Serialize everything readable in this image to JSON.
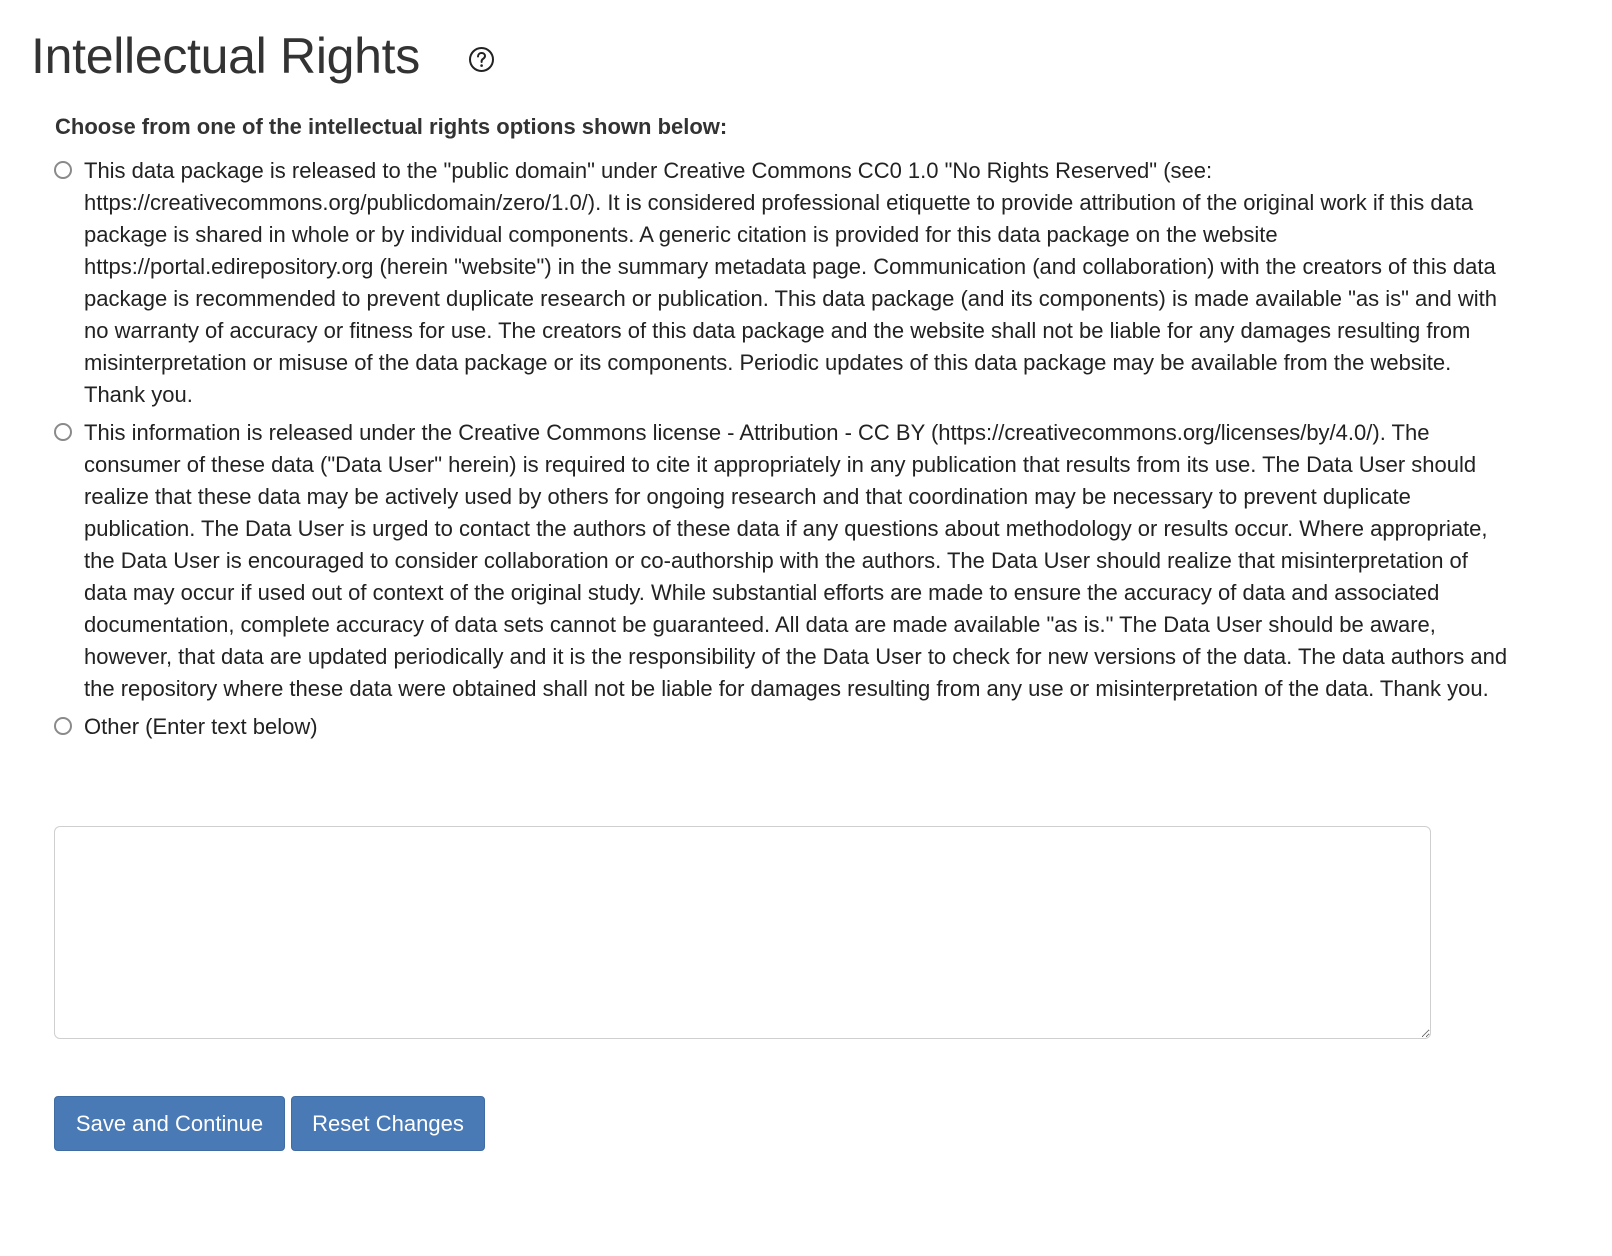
{
  "header": {
    "title": "Intellectual Rights",
    "help_icon": "help-circle-icon"
  },
  "form": {
    "instructions": "Choose from one of the intellectual rights options shown below:",
    "options": [
      {
        "label": "This data package is released to the \"public domain\" under Creative Commons CC0 1.0 \"No Rights Reserved\" (see: https://creativecommons.org/publicdomain/zero/1.0/). It is considered professional etiquette to provide attribution of the original work if this data package is shared in whole or by individual components. A generic citation is provided for this data package on the website https://portal.edirepository.org (herein \"website\") in the summary metadata page. Communication (and collaboration) with the creators of this data package is recommended to prevent duplicate research or publication. This data package (and its components) is made available \"as is\" and with no warranty of accuracy or fitness for use. The creators of this data package and the website shall not be liable for any damages resulting from misinterpretation or misuse of the data package or its components. Periodic updates of this data package may be available from the website. Thank you.",
        "selected": false
      },
      {
        "label": "This information is released under the Creative Commons license - Attribution - CC BY (https://creativecommons.org/licenses/by/4.0/). The consumer of these data (\"Data User\" herein) is required to cite it appropriately in any publication that results from its use. The Data User should realize that these data may be actively used by others for ongoing research and that coordination may be necessary to prevent duplicate publication. The Data User is urged to contact the authors of these data if any questions about methodology or results occur. Where appropriate, the Data User is encouraged to consider collaboration or co-authorship with the authors. The Data User should realize that misinterpretation of data may occur if used out of context of the original study. While substantial efforts are made to ensure the accuracy of data and associated documentation, complete accuracy of data sets cannot be guaranteed. All data are made available \"as is.\" The Data User should be aware, however, that data are updated periodically and it is the responsibility of the Data User to check for new versions of the data. The data authors and the repository where these data were obtained shall not be liable for damages resulting from any use or misinterpretation of the data. Thank you.",
        "selected": false
      },
      {
        "label": "Other (Enter text below)",
        "selected": false
      }
    ],
    "other_text": {
      "value": ""
    }
  },
  "actions": {
    "save_label": "Save and Continue",
    "reset_label": "Reset Changes"
  },
  "colors": {
    "button_bg": "#4a7ab5",
    "button_text": "#ffffff",
    "radio_border": "#8a8a8a",
    "text": "#222222"
  }
}
